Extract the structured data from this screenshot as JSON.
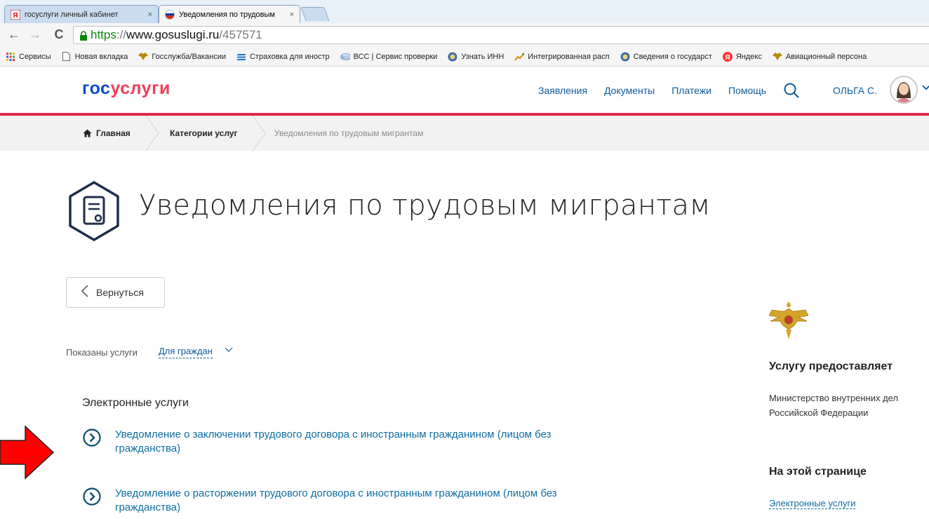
{
  "browser": {
    "tabs": [
      {
        "title": "госуслуги личный кабинет",
        "close": "×",
        "active": false
      },
      {
        "title": "Уведомления по трудовым",
        "close": "×",
        "active": true
      }
    ],
    "url": {
      "scheme": "https",
      "sep": "://",
      "host": "www.gosuslugi.ru",
      "path": "/457571"
    },
    "bookmarks": [
      {
        "label": "Сервисы",
        "icon": "apps-grid-icon"
      },
      {
        "label": "Новая вкладка",
        "icon": "page-icon"
      },
      {
        "label": "Госслужба/Вакансии",
        "icon": "eagle-icon"
      },
      {
        "label": "Страховка для иностр",
        "icon": "stripes-icon"
      },
      {
        "label": "ВСС | Сервис проверки",
        "icon": "bcc-icon"
      },
      {
        "label": "Узнать ИНН",
        "icon": "fns-icon"
      },
      {
        "label": "Интегрированная расп",
        "icon": "chart-icon"
      },
      {
        "label": "Сведения о государст",
        "icon": "fns-icon"
      },
      {
        "label": "Яндекс",
        "icon": "yandex-icon"
      },
      {
        "label": "Авиационный персона",
        "icon": "eagle-icon"
      }
    ]
  },
  "header": {
    "logo_part1": "гос",
    "logo_part2": "услуги",
    "nav": [
      "Заявления",
      "Документы",
      "Платежи",
      "Помощь"
    ],
    "user": "ОЛЬГА С."
  },
  "breadcrumbs": {
    "home": "Главная",
    "category": "Категории услуг",
    "current": "Уведомления по трудовым мигрантам"
  },
  "page": {
    "title": "Уведомления по трудовым мигрантам",
    "back": "Вернуться",
    "shown_label": "Показаны услуги",
    "shown_value": "Для граждан",
    "section_title": "Электронные услуги",
    "services": [
      {
        "line1": "Уведомление о заключении трудового договора с иностранным гражданином (лицом без",
        "line2": "гражданства)"
      },
      {
        "line1": "Уведомление о расторжении трудового договора с иностранным гражданином (лицом без",
        "line2": "гражданства)"
      }
    ]
  },
  "sidebar": {
    "provider_heading": "Услугу предоставляет",
    "provider_line1": "Министерство внутренних дел",
    "provider_line2": "Российской Федерации",
    "onpage_heading": "На этой странице",
    "onpage_link": "Электронные услуги"
  },
  "colors": {
    "brand_blue": "#0d4cd3",
    "brand_red": "#ee3f58",
    "header_line": "#e4284a",
    "link": "#0d6da3",
    "annotation_arrow": "#ff0000"
  }
}
